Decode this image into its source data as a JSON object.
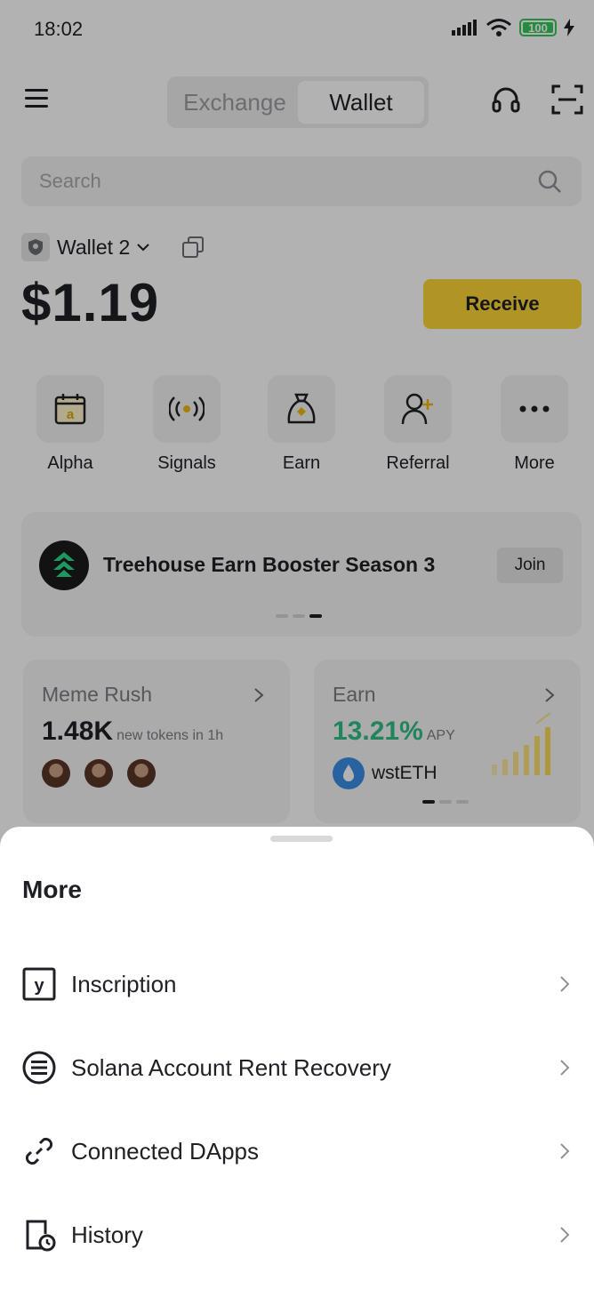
{
  "status_bar": {
    "time": "18:02",
    "battery": "100"
  },
  "header": {
    "tabs": [
      {
        "label": "Exchange",
        "active": false
      },
      {
        "label": "Wallet",
        "active": true
      }
    ]
  },
  "search": {
    "placeholder": "Search"
  },
  "wallet": {
    "name": "Wallet 2",
    "balance": "$1.19",
    "receive_label": "Receive"
  },
  "actions": [
    {
      "label": "Alpha",
      "icon": "alpha-calendar-icon"
    },
    {
      "label": "Signals",
      "icon": "signals-icon"
    },
    {
      "label": "Earn",
      "icon": "earn-bag-icon"
    },
    {
      "label": "Referral",
      "icon": "add-user-icon"
    },
    {
      "label": "More",
      "icon": "more-dots-icon"
    }
  ],
  "banner": {
    "title": "Treehouse Earn Booster Season 3",
    "join_label": "Join"
  },
  "cards": {
    "meme": {
      "title": "Meme Rush",
      "value": "1.48K",
      "sub": "new tokens in 1h"
    },
    "earn": {
      "title": "Earn",
      "value": "13.21%",
      "sub": "APY",
      "token": "wstETH"
    }
  },
  "sheet": {
    "title": "More",
    "items": [
      {
        "label": "Inscription",
        "icon": "inscription-icon"
      },
      {
        "label": "Solana Account Rent Recovery",
        "icon": "solana-icon"
      },
      {
        "label": "Connected DApps",
        "icon": "link-icon"
      },
      {
        "label": "History",
        "icon": "history-icon"
      }
    ]
  },
  "colors": {
    "accent": "#fcd535",
    "positive": "#2ebd85",
    "text": "#1e2026"
  }
}
